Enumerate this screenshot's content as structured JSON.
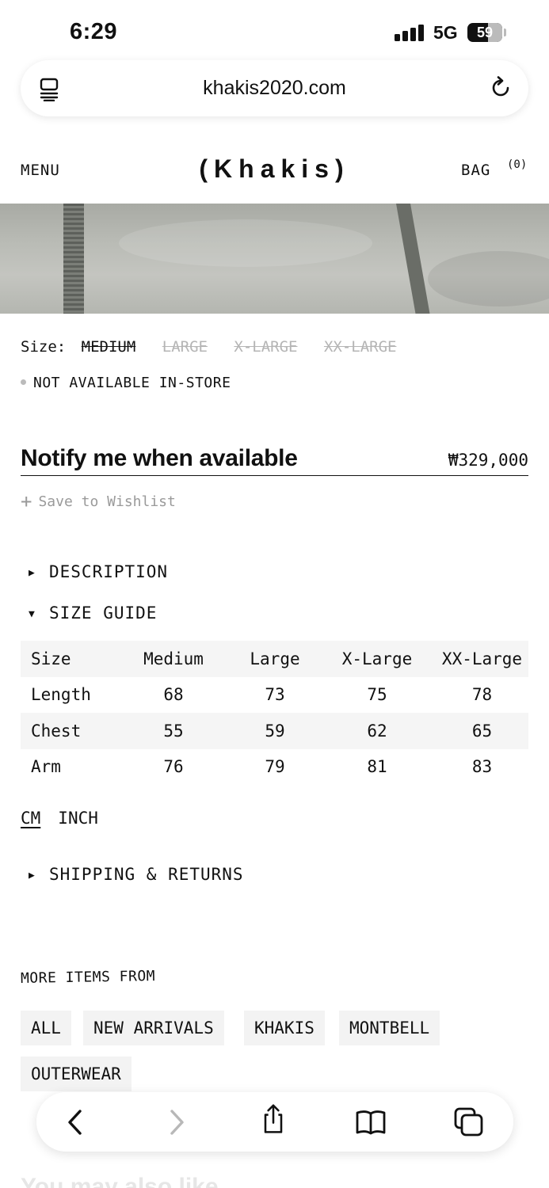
{
  "status_bar": {
    "time": "6:29",
    "network": "5G",
    "battery": "59"
  },
  "browser": {
    "url": "khakis2020.com"
  },
  "site_header": {
    "menu": "MENU",
    "logo": "(Khakis)",
    "bag": "BAG",
    "bag_count": "(0)"
  },
  "product": {
    "size_label": "Size:",
    "sizes": [
      {
        "label": "MEDIUM",
        "selected": true
      },
      {
        "label": "LARGE",
        "selected": false
      },
      {
        "label": "X-LARGE",
        "selected": false
      },
      {
        "label": "XX-LARGE",
        "selected": false
      }
    ],
    "availability": "NOT AVAILABLE IN-STORE",
    "notify": "Notify me when available",
    "price": "₩329,000",
    "wishlist": "Save to Wishlist"
  },
  "accordions": {
    "description": "DESCRIPTION",
    "size_guide": "SIZE GUIDE",
    "shipping": "SHIPPING & RETURNS"
  },
  "size_table": {
    "headers": [
      "Size",
      "Medium",
      "Large",
      "X-Large",
      "XX-Large"
    ],
    "rows": [
      [
        "Length",
        "68",
        "73",
        "75",
        "78"
      ],
      [
        "Chest",
        "55",
        "59",
        "62",
        "65"
      ],
      [
        "Arm",
        "76",
        "79",
        "81",
        "83"
      ]
    ]
  },
  "units": {
    "cm": "CM",
    "inch": "INCH"
  },
  "more_items": {
    "title": "MORE ITEMS FROM",
    "tags": [
      "ALL",
      "NEW ARRIVALS",
      "KHAKIS",
      "MONTBELL",
      "OUTERWEAR"
    ]
  },
  "partial_section_title": "You may also like",
  "toolbar_icons": [
    "back-icon",
    "forward-icon",
    "share-icon",
    "bookmarks-icon",
    "tabs-icon"
  ]
}
